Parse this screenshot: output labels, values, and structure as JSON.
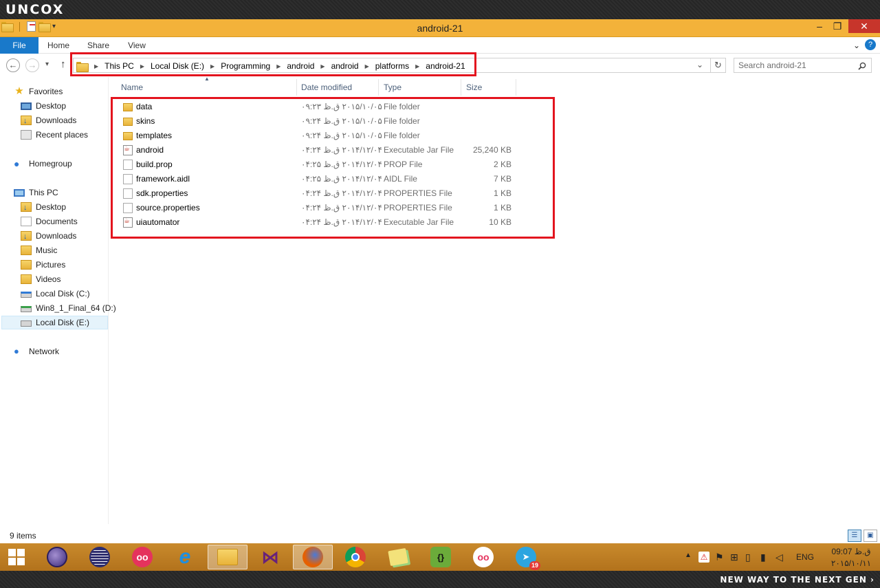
{
  "brand": "UNCOX",
  "slogan": "NEW WAY TO THE NEXT GEN ›",
  "window": {
    "title": "android-21",
    "minimize": "–",
    "maximize": "❐",
    "close": "✕",
    "accent": "#f3b23a"
  },
  "ribbon": {
    "tabs": [
      "File",
      "Home",
      "Share",
      "View"
    ],
    "expand": "⌄",
    "help": "?"
  },
  "address": {
    "back": "←",
    "forward": "→",
    "recent": "▾",
    "up": "↑",
    "crumbs": [
      "This PC",
      "Local Disk (E:)",
      "Programming",
      "android",
      "android",
      "platforms",
      "android-21"
    ],
    "dropdown": "⌄",
    "refresh": "↻"
  },
  "search": {
    "placeholder": "Search android-21",
    "icon": "search-icon"
  },
  "nav": {
    "favorites": "Favorites",
    "fav_items": [
      "Desktop",
      "Downloads",
      "Recent places"
    ],
    "homegroup": "Homegroup",
    "this_pc": "This PC",
    "pc_items": [
      "Desktop",
      "Documents",
      "Downloads",
      "Music",
      "Pictures",
      "Videos",
      "Local Disk (C:)",
      "Win8_1_Final_64 (D:)",
      "Local Disk (E:)"
    ],
    "network": "Network"
  },
  "columns": {
    "name": "Name",
    "date": "Date modified",
    "type": "Type",
    "size": "Size"
  },
  "files": [
    {
      "name": "data",
      "date": "۲۰۱۵/۱۰/۰۵ ق.ظ ۰۹:۲۳",
      "type": "File folder",
      "size": "",
      "icon": "folder-icon"
    },
    {
      "name": "skins",
      "date": "۲۰۱۵/۱۰/۰۵ ق.ظ ۰۹:۲۴",
      "type": "File folder",
      "size": "",
      "icon": "folder-icon"
    },
    {
      "name": "templates",
      "date": "۲۰۱۵/۱۰/۰۵ ق.ظ ۰۹:۲۴",
      "type": "File folder",
      "size": "",
      "icon": "folder-icon"
    },
    {
      "name": "android",
      "date": "۲۰۱۴/۱۲/۰۴ ق.ظ ۰۴:۲۴",
      "type": "Executable Jar File",
      "size": "25,240 KB",
      "icon": "jar-icon"
    },
    {
      "name": "build.prop",
      "date": "۲۰۱۴/۱۲/۰۴ ق.ظ ۰۴:۲۵",
      "type": "PROP File",
      "size": "2 KB",
      "icon": "file-icon"
    },
    {
      "name": "framework.aidl",
      "date": "۲۰۱۴/۱۲/۰۴ ق.ظ ۰۴:۲۵",
      "type": "AIDL File",
      "size": "7 KB",
      "icon": "file-icon"
    },
    {
      "name": "sdk.properties",
      "date": "۲۰۱۴/۱۲/۰۴ ق.ظ ۰۴:۲۴",
      "type": "PROPERTIES File",
      "size": "1 KB",
      "icon": "file-icon"
    },
    {
      "name": "source.properties",
      "date": "۲۰۱۴/۱۲/۰۴ ق.ظ ۰۴:۲۴",
      "type": "PROPERTIES File",
      "size": "1 KB",
      "icon": "file-icon"
    },
    {
      "name": "uiautomator",
      "date": "۲۰۱۴/۱۲/۰۴ ق.ظ ۰۴:۲۴",
      "type": "Executable Jar File",
      "size": "10 KB",
      "icon": "jar-icon"
    }
  ],
  "status": {
    "items": "9 items"
  },
  "taskbar": {
    "apps": [
      "eclipse-purple-icon",
      "eclipse-icon",
      "flickr-icon",
      "ie-icon",
      "file-explorer-icon",
      "visual-studio-icon",
      "firefox-icon",
      "chrome-icon",
      "sticky-notes-icon",
      "brackets-icon",
      "flickr-icon-2",
      "telegram-icon"
    ],
    "brackets_label": "{}",
    "telegram_badge": "19",
    "lang": "ENG",
    "time": "09:07 ق.ظ",
    "date": "۲۰۱۵/۱۰/۱۱",
    "accent": "#c98a2c"
  }
}
